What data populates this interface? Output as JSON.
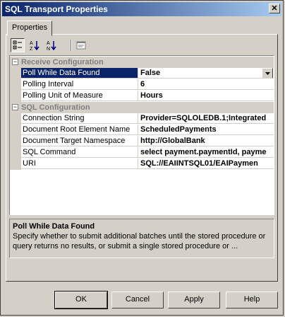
{
  "window": {
    "title": "SQL Transport Properties",
    "close_label": "✕"
  },
  "tabs": [
    {
      "label": "Properties"
    }
  ],
  "toolbar": {
    "buttons": [
      "categorized-icon",
      "alphabetical-icon",
      "sort-az-icon",
      "property-pages-icon"
    ]
  },
  "grid": {
    "categories": [
      {
        "name": "Receive Configuration",
        "expander": "⊟",
        "properties": [
          {
            "name": "Poll While Data Found",
            "value": "False",
            "selected": true
          },
          {
            "name": "Polling Interval",
            "value": "6"
          },
          {
            "name": "Polling Unit of Measure",
            "value": "Hours"
          }
        ]
      },
      {
        "name": "SQL Configuration",
        "expander": "⊟",
        "properties": [
          {
            "name": "Connection String",
            "value": "Provider=SQLOLEDB.1;Integrated"
          },
          {
            "name": "Document Root Element Name",
            "value": "ScheduledPayments"
          },
          {
            "name": "Document Target Namespace",
            "value": "http://GlobalBank"
          },
          {
            "name": "SQL Command",
            "value": "select payment.paymentId, payme"
          },
          {
            "name": "URI",
            "value": "SQL://EAIINTSQL01/EAIPaymen"
          }
        ]
      }
    ]
  },
  "description": {
    "title": "Poll While Data Found",
    "text": "Specify whether to submit additional batches until the stored procedure or query returns no results, or submit a single stored procedure or ..."
  },
  "buttons": {
    "ok": "OK",
    "cancel": "Cancel",
    "apply": "Apply",
    "help": "Help"
  }
}
